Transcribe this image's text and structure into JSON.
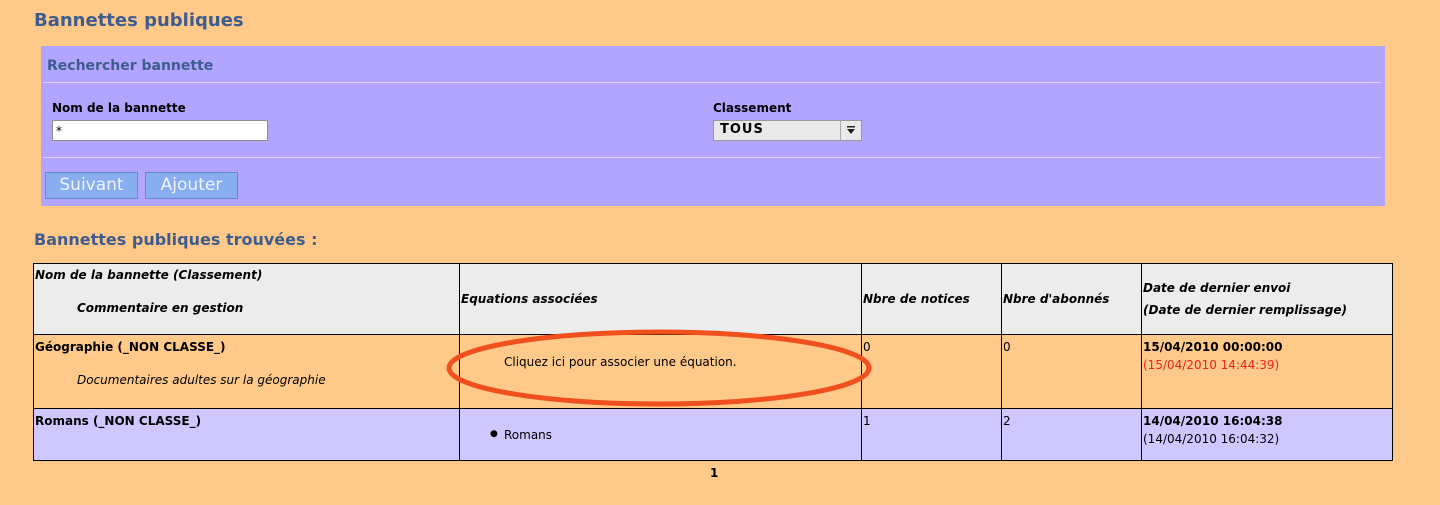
{
  "page": {
    "title": "Bannettes publiques"
  },
  "search": {
    "title": "Rechercher bannette",
    "name_label": "Nom de la bannette",
    "name_value": "*",
    "classement_label": "Classement",
    "classement_selected": "TOUS",
    "next_button": "Suivant",
    "add_button": "Ajouter"
  },
  "results": {
    "title": "Bannettes publiques trouvées :",
    "headers": {
      "name": "Nom de la bannette (Classement)",
      "comment": "Commentaire en gestion",
      "equations": "Equations associées",
      "notices": "Nbre de notices",
      "abonnes": "Nbre d'abonnés",
      "last_send": "Date de dernier envoi",
      "last_fill": "(Date de dernier remplissage)"
    },
    "rows": [
      {
        "name": "Géographie (_NON CLASSE_)",
        "comment": "Documentaires adultes sur la géographie",
        "equation_link": "Cliquez ici pour associer une équation.",
        "notices": "0",
        "abonnes": "0",
        "last_send": "15/04/2010 00:00:00",
        "last_fill": "(15/04/2010 14:44:39)"
      },
      {
        "name": "Romans (_NON CLASSE_)",
        "equation_item": "Romans",
        "notices": "1",
        "abonnes": "2",
        "last_send": "14/04/2010 16:04:38",
        "last_fill": "(14/04/2010 16:04:32)"
      }
    ]
  },
  "pagination": {
    "current": "1"
  },
  "colors": {
    "background": "#ffc98a",
    "search_panel": "#b1a5ff",
    "title": "#3e5d8e",
    "highlight_ellipse": "#f0501e",
    "row_alt": "#cfc7ff",
    "date_red": "#e8261a"
  }
}
